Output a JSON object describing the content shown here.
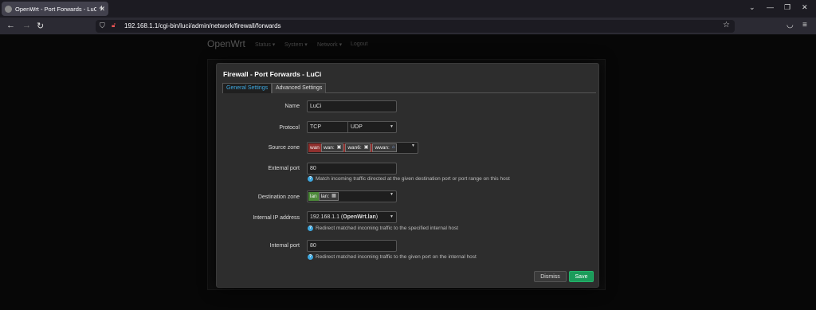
{
  "browser": {
    "tab_title": "OpenWrt - Port Forwards - LuCI",
    "url": "192.168.1.1/cgi-bin/luci/admin/network/firewall/forwards"
  },
  "background": {
    "brand": "OpenWrt",
    "menu": [
      "Status ▾",
      "System ▾",
      "Network ▾",
      "Logout"
    ]
  },
  "modal": {
    "title": "Firewall - Port Forwards - LuCi",
    "tabs": [
      "General Settings",
      "Advanced Settings"
    ],
    "fields": {
      "name": {
        "label": "Name",
        "value": "LuCi"
      },
      "protocol": {
        "label": "Protocol",
        "values": [
          "TCP",
          "UDP"
        ]
      },
      "source_zone": {
        "label": "Source zone",
        "zone": "wan",
        "zone_color": "#90302e",
        "interfaces": [
          "wan:",
          "wan6:",
          "wwan:"
        ]
      },
      "external_port": {
        "label": "External port",
        "value": "80",
        "help": "Match incoming traffic directed at the given destination port or port range on this host"
      },
      "dest_zone": {
        "label": "Destination zone",
        "zone": "lan",
        "zone_color": "#4d8a3a",
        "interfaces": [
          "lan:"
        ]
      },
      "internal_ip": {
        "label": "Internal IP address",
        "value": "192.168.1.1",
        "host": "OpenWrt.lan",
        "help": "Redirect matched incoming traffic to the specified internal host"
      },
      "internal_port": {
        "label": "Internal port",
        "value": "80",
        "help": "Redirect matched incoming traffic to the given port on the internal host"
      }
    },
    "buttons": {
      "dismiss": "Dismiss",
      "save": "Save"
    }
  }
}
